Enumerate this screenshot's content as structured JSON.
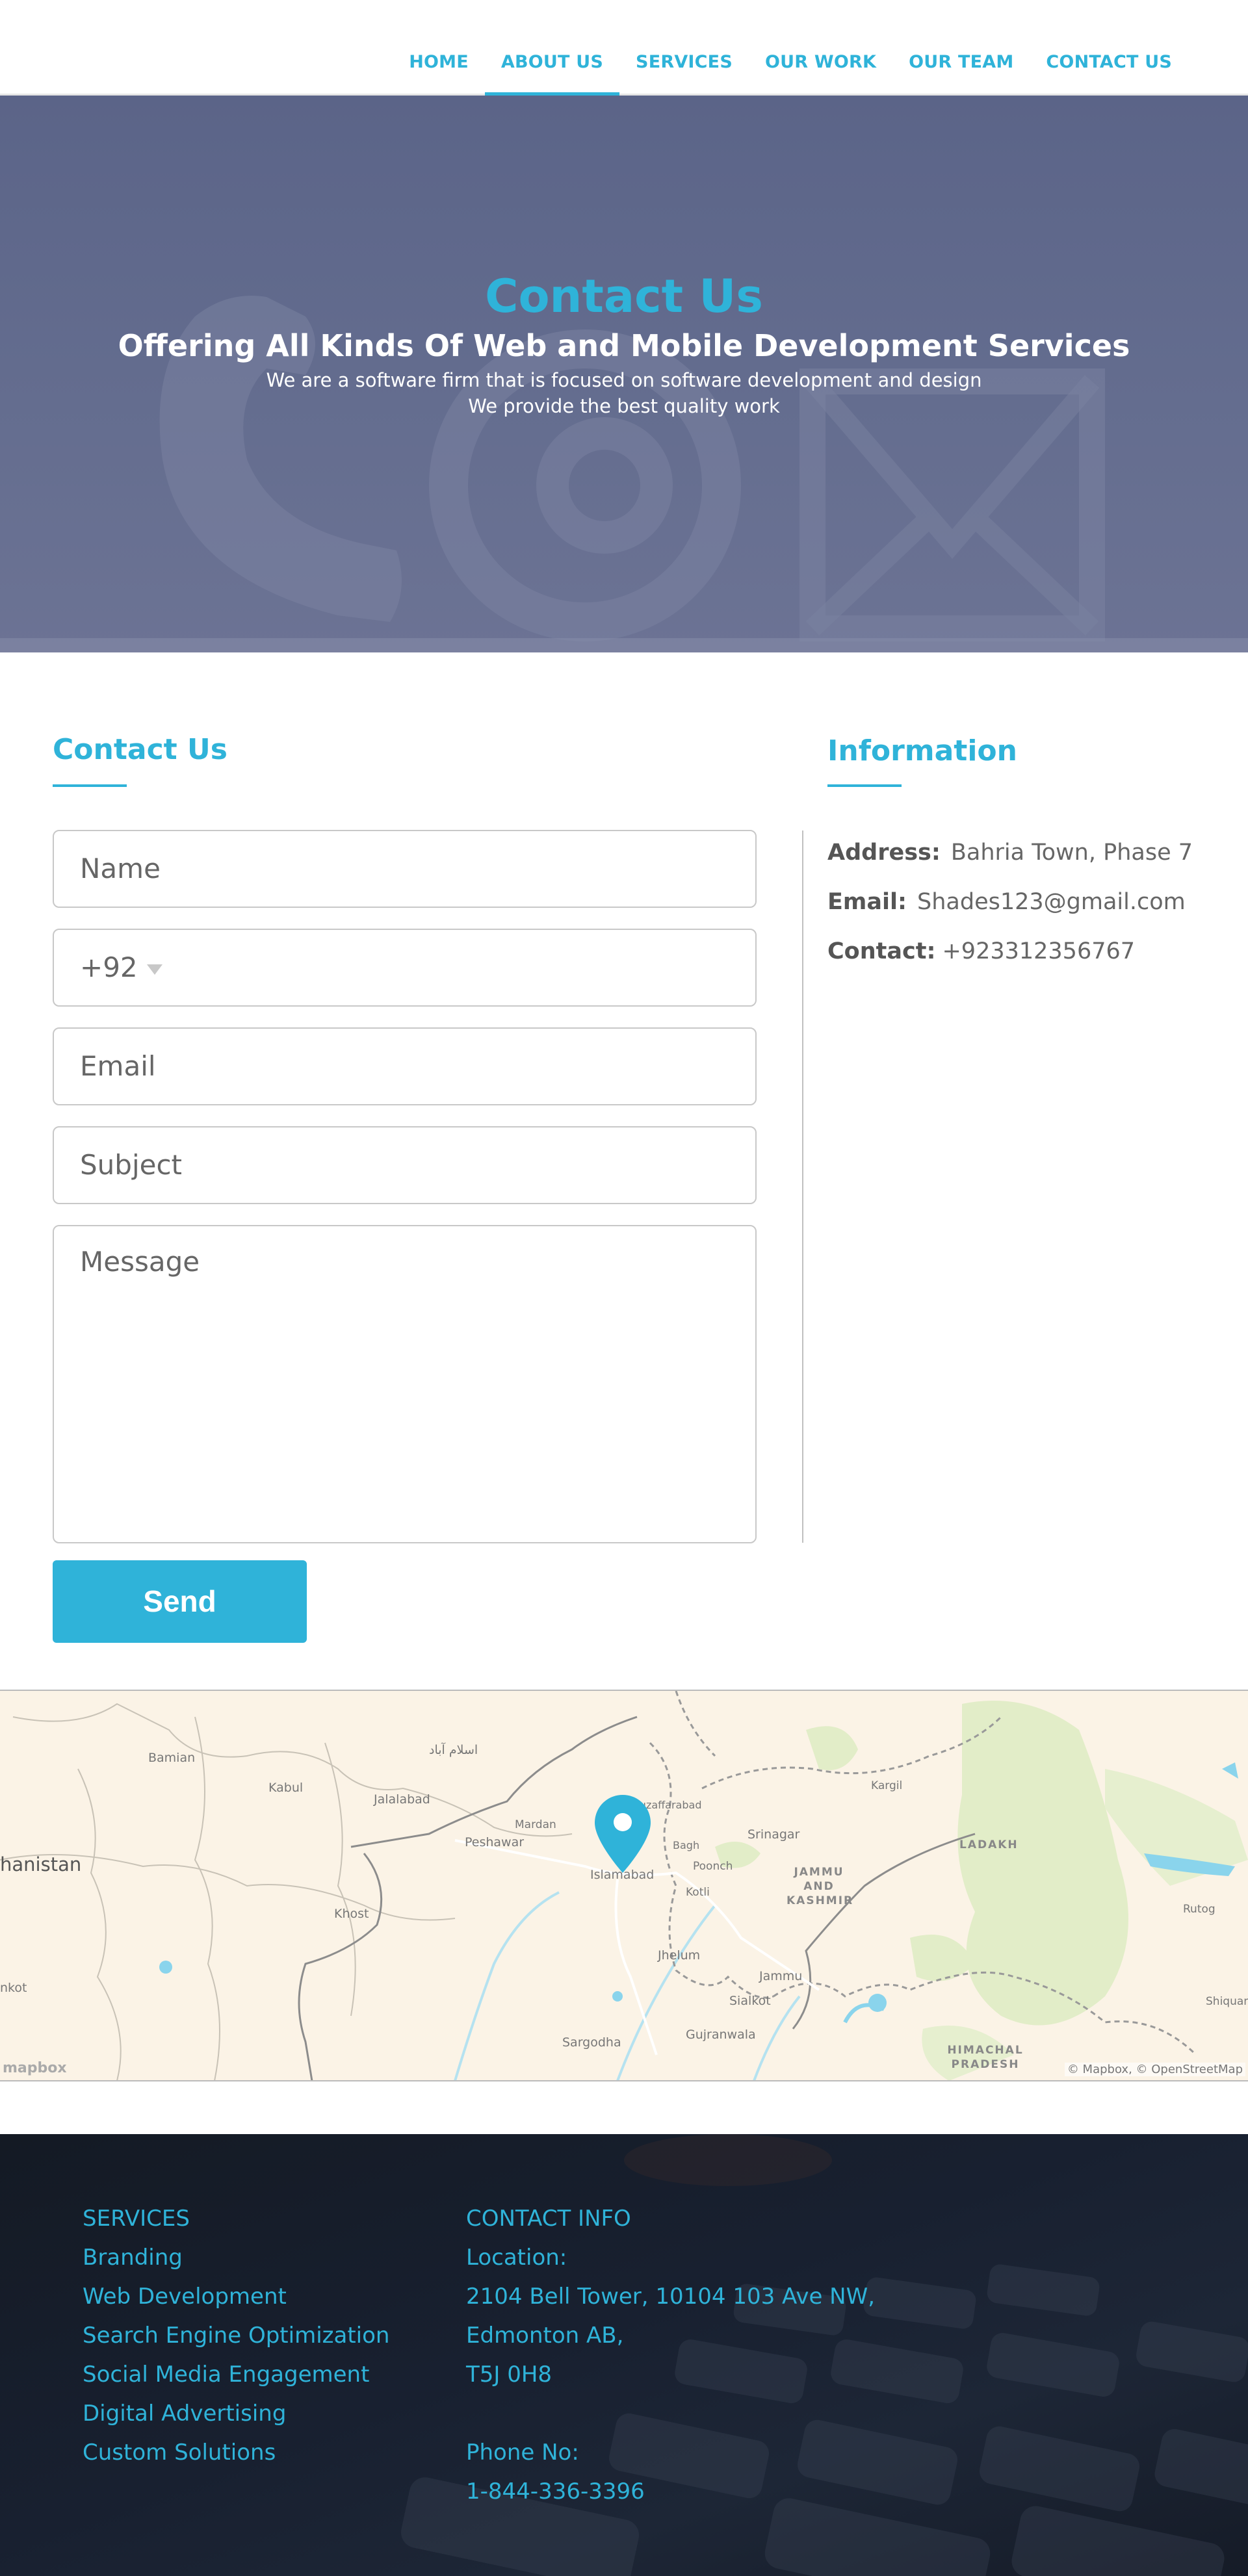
{
  "nav": {
    "items": [
      {
        "label": "HOME"
      },
      {
        "label": "ABOUT US"
      },
      {
        "label": "SERVICES"
      },
      {
        "label": "OUR WORK"
      },
      {
        "label": "OUR TEAM"
      },
      {
        "label": "CONTACT US"
      }
    ],
    "active_label": "ABOUT US"
  },
  "hero": {
    "title": "Contact Us",
    "subtitle": "Offering All Kinds Of Web and Mobile Development Services",
    "line1": "We are a software firm that is focused on software development and design",
    "line2": "We provide the best quality work"
  },
  "contact_form": {
    "heading": "Contact Us",
    "name_placeholder": "Name",
    "phone_code": "+92",
    "email_placeholder": "Email",
    "subject_placeholder": "Subject",
    "message_placeholder": "Message",
    "send_label": "Send"
  },
  "information": {
    "heading": "Information",
    "address_label": "Address:",
    "address_value": "Bahria Town, Phase 7",
    "email_label": "Email:",
    "email_value": "Shades123@gmail.com",
    "contact_label": "Contact:",
    "contact_value": "+923312356767"
  },
  "map": {
    "labels": {
      "bamian": "Bamian",
      "kabul": "Kabul",
      "jalalabad": "Jalalabad",
      "islamabad_urdu": "اسلام آباد",
      "peshawar": "Peshawar",
      "mardan": "Mardan",
      "muzaffarabad": "Muzaffarabad",
      "islamabad": "Islamabad",
      "bagh": "Bagh",
      "poonch": "Poonch",
      "kotli": "Kotli",
      "srinagar": "Srinagar",
      "kargil": "Kargil",
      "ladakh": "LADAKH",
      "jammu_kashmir": "JAMMU AND KASHMIR",
      "afghanistan": "hanistan",
      "khost": "Khost",
      "jhelum": "Jhelum",
      "jammu": "Jammu",
      "sialkot": "Sialkot",
      "rutog": "Rutog",
      "nkot": "nkot",
      "sargodha": "Sargodha",
      "gujranwala": "Gujranwala",
      "himachal": "HIMACHAL PRADESH",
      "shiquan": "Shiquan"
    },
    "logo": "mapbox",
    "attribution": "© Mapbox, © OpenStreetMap"
  },
  "footer": {
    "services_heading": "SERVICES",
    "services": [
      "Branding",
      "Web Development",
      "Search Engine Optimization",
      "Social Media Engagement",
      "Digital Advertising",
      "Custom Solutions"
    ],
    "contact_heading": "CONTACT INFO",
    "location_label": "Location:",
    "address_lines": [
      "2104 Bell Tower, 10104 103 Ave NW,",
      "Edmonton AB,",
      "T5J 0H8"
    ],
    "phone_label": "Phone No:",
    "phone_value": "1-844-336-3396"
  },
  "colors": {
    "accent": "#2fb3d9",
    "hero_overlay": "#5b6488",
    "footer_bg": "#161d2a"
  },
  "icons": {
    "map_marker": "map-marker-icon",
    "phone_dropdown": "chevron-down-icon"
  }
}
